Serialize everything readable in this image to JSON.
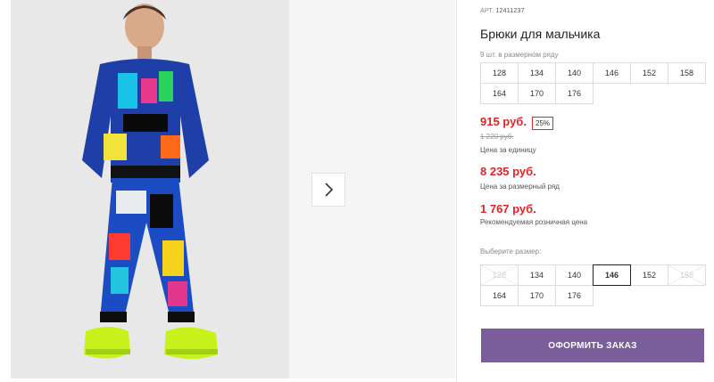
{
  "product": {
    "art_label": "АРТ.",
    "art_value": "12411237",
    "title": "Брюки для мальчика",
    "row_note": "9 шт. в размерном ряду"
  },
  "size_row": [
    "128",
    "134",
    "140",
    "146",
    "152",
    "158",
    "164",
    "170",
    "176"
  ],
  "prices": {
    "current": "915 руб.",
    "discount": "25%",
    "old": "1 220 руб.",
    "unit_label": "Цена за единицу",
    "row_price": "8 235 руб.",
    "row_label": "Цена за размерный ряд",
    "rrp_price": "1 767 руб.",
    "rrp_label": "Рекомендуемая розничная цена"
  },
  "size_select": {
    "label": "Выберите размер:",
    "options": [
      {
        "value": "128",
        "state": "disabled"
      },
      {
        "value": "134",
        "state": "available"
      },
      {
        "value": "140",
        "state": "available"
      },
      {
        "value": "146",
        "state": "selected"
      },
      {
        "value": "152",
        "state": "available"
      },
      {
        "value": "158",
        "state": "disabled"
      },
      {
        "value": "164",
        "state": "available"
      },
      {
        "value": "170",
        "state": "available"
      },
      {
        "value": "176",
        "state": "available"
      }
    ]
  },
  "actions": {
    "order_label": "ОФОРМИТЬ ЗАКАЗ",
    "next_icon": "chevron-right-icon"
  },
  "colors": {
    "accent": "#7a5e9c",
    "price": "#e0242a"
  }
}
